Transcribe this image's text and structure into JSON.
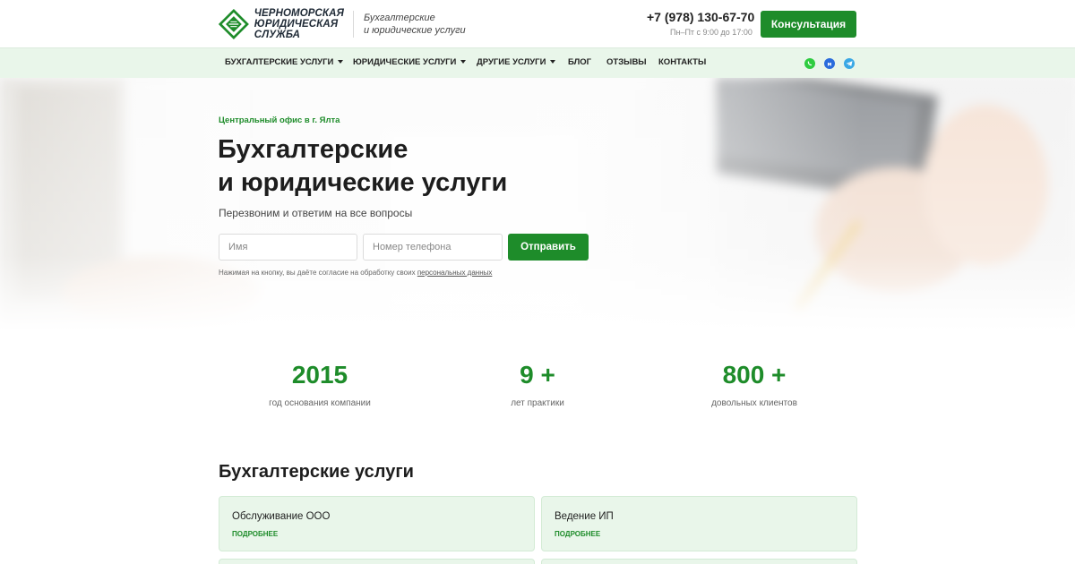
{
  "header": {
    "logo_lines": [
      "ЧЕРНОМОРСКАЯ",
      "ЮРИДИЧЕСКАЯ",
      "СЛУЖБА"
    ],
    "tagline_line1": "Бухгалтерские",
    "tagline_line2": "и юридические услуги",
    "phone": "+7 (978) 130-67-70",
    "hours": "Пн–Пт с 9:00 до 17:00",
    "consult_label": "Консультация",
    "brand_color": "#1e8c2a"
  },
  "nav": {
    "items": [
      {
        "label": "Бухгалтерские услуги",
        "dropdown": true
      },
      {
        "label": "Юридические услуги",
        "dropdown": true
      },
      {
        "label": "Другие услуги",
        "dropdown": true
      },
      {
        "label": "Блог",
        "dropdown": false
      },
      {
        "label": "Отзывы",
        "dropdown": false
      },
      {
        "label": "Контакты",
        "dropdown": false
      }
    ],
    "social_icons": [
      "whatsapp-icon",
      "max-icon",
      "telegram-icon"
    ]
  },
  "hero": {
    "office": "Центральный офис в г. Ялта",
    "title_line1": "Бухгалтерские",
    "title_line2": "и юридические услуги",
    "subtitle": "Перезвоним и ответим на все вопросы",
    "name_placeholder": "Имя",
    "phone_placeholder": "Номер телефона",
    "submit_label": "Отправить",
    "consent_text": "Нажимая на кнопку, вы даёте согласие на обработку своих ",
    "consent_link": "персональных данных"
  },
  "stats": [
    {
      "value": "2015",
      "label": "год основания компании"
    },
    {
      "value": "9 +",
      "label": "лет практики"
    },
    {
      "value": "800 +",
      "label": "довольных клиентов"
    }
  ],
  "services": {
    "title": "Бухгалтерские услуги",
    "cards": [
      {
        "title": "Обслуживание ООО",
        "more": "Подробнее"
      },
      {
        "title": "Ведение ИП",
        "more": "Подробнее"
      }
    ]
  }
}
